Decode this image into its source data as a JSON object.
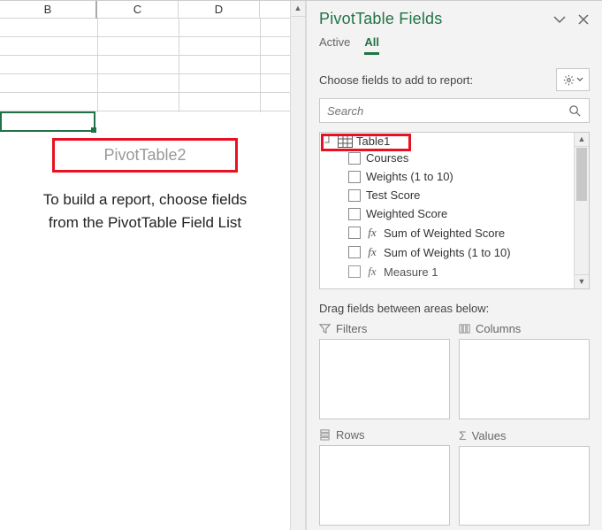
{
  "grid": {
    "col_b": "B",
    "col_c": "C",
    "col_d": "D"
  },
  "pivot_placeholder": {
    "title": "PivotTable2",
    "line1": "To build a report, choose fields",
    "line2": "from the PivotTable Field List"
  },
  "pane": {
    "title": "PivotTable Fields",
    "tab_active": "Active",
    "tab_all": "All",
    "choose_label": "Choose fields to add to report:",
    "search_placeholder": "Search",
    "table_name": "Table1",
    "fields": {
      "courses": "Courses",
      "weights": "Weights (1 to 10)",
      "test_score": "Test Score",
      "weighted_score": "Weighted Score",
      "sum_weighted": "Sum of Weighted Score",
      "sum_weights": "Sum of Weights (1 to 10)",
      "measure1": "Measure 1"
    },
    "drag_hint": "Drag fields between areas below:",
    "area_filters": "Filters",
    "area_columns": "Columns",
    "area_rows": "Rows",
    "area_values": "Values"
  }
}
